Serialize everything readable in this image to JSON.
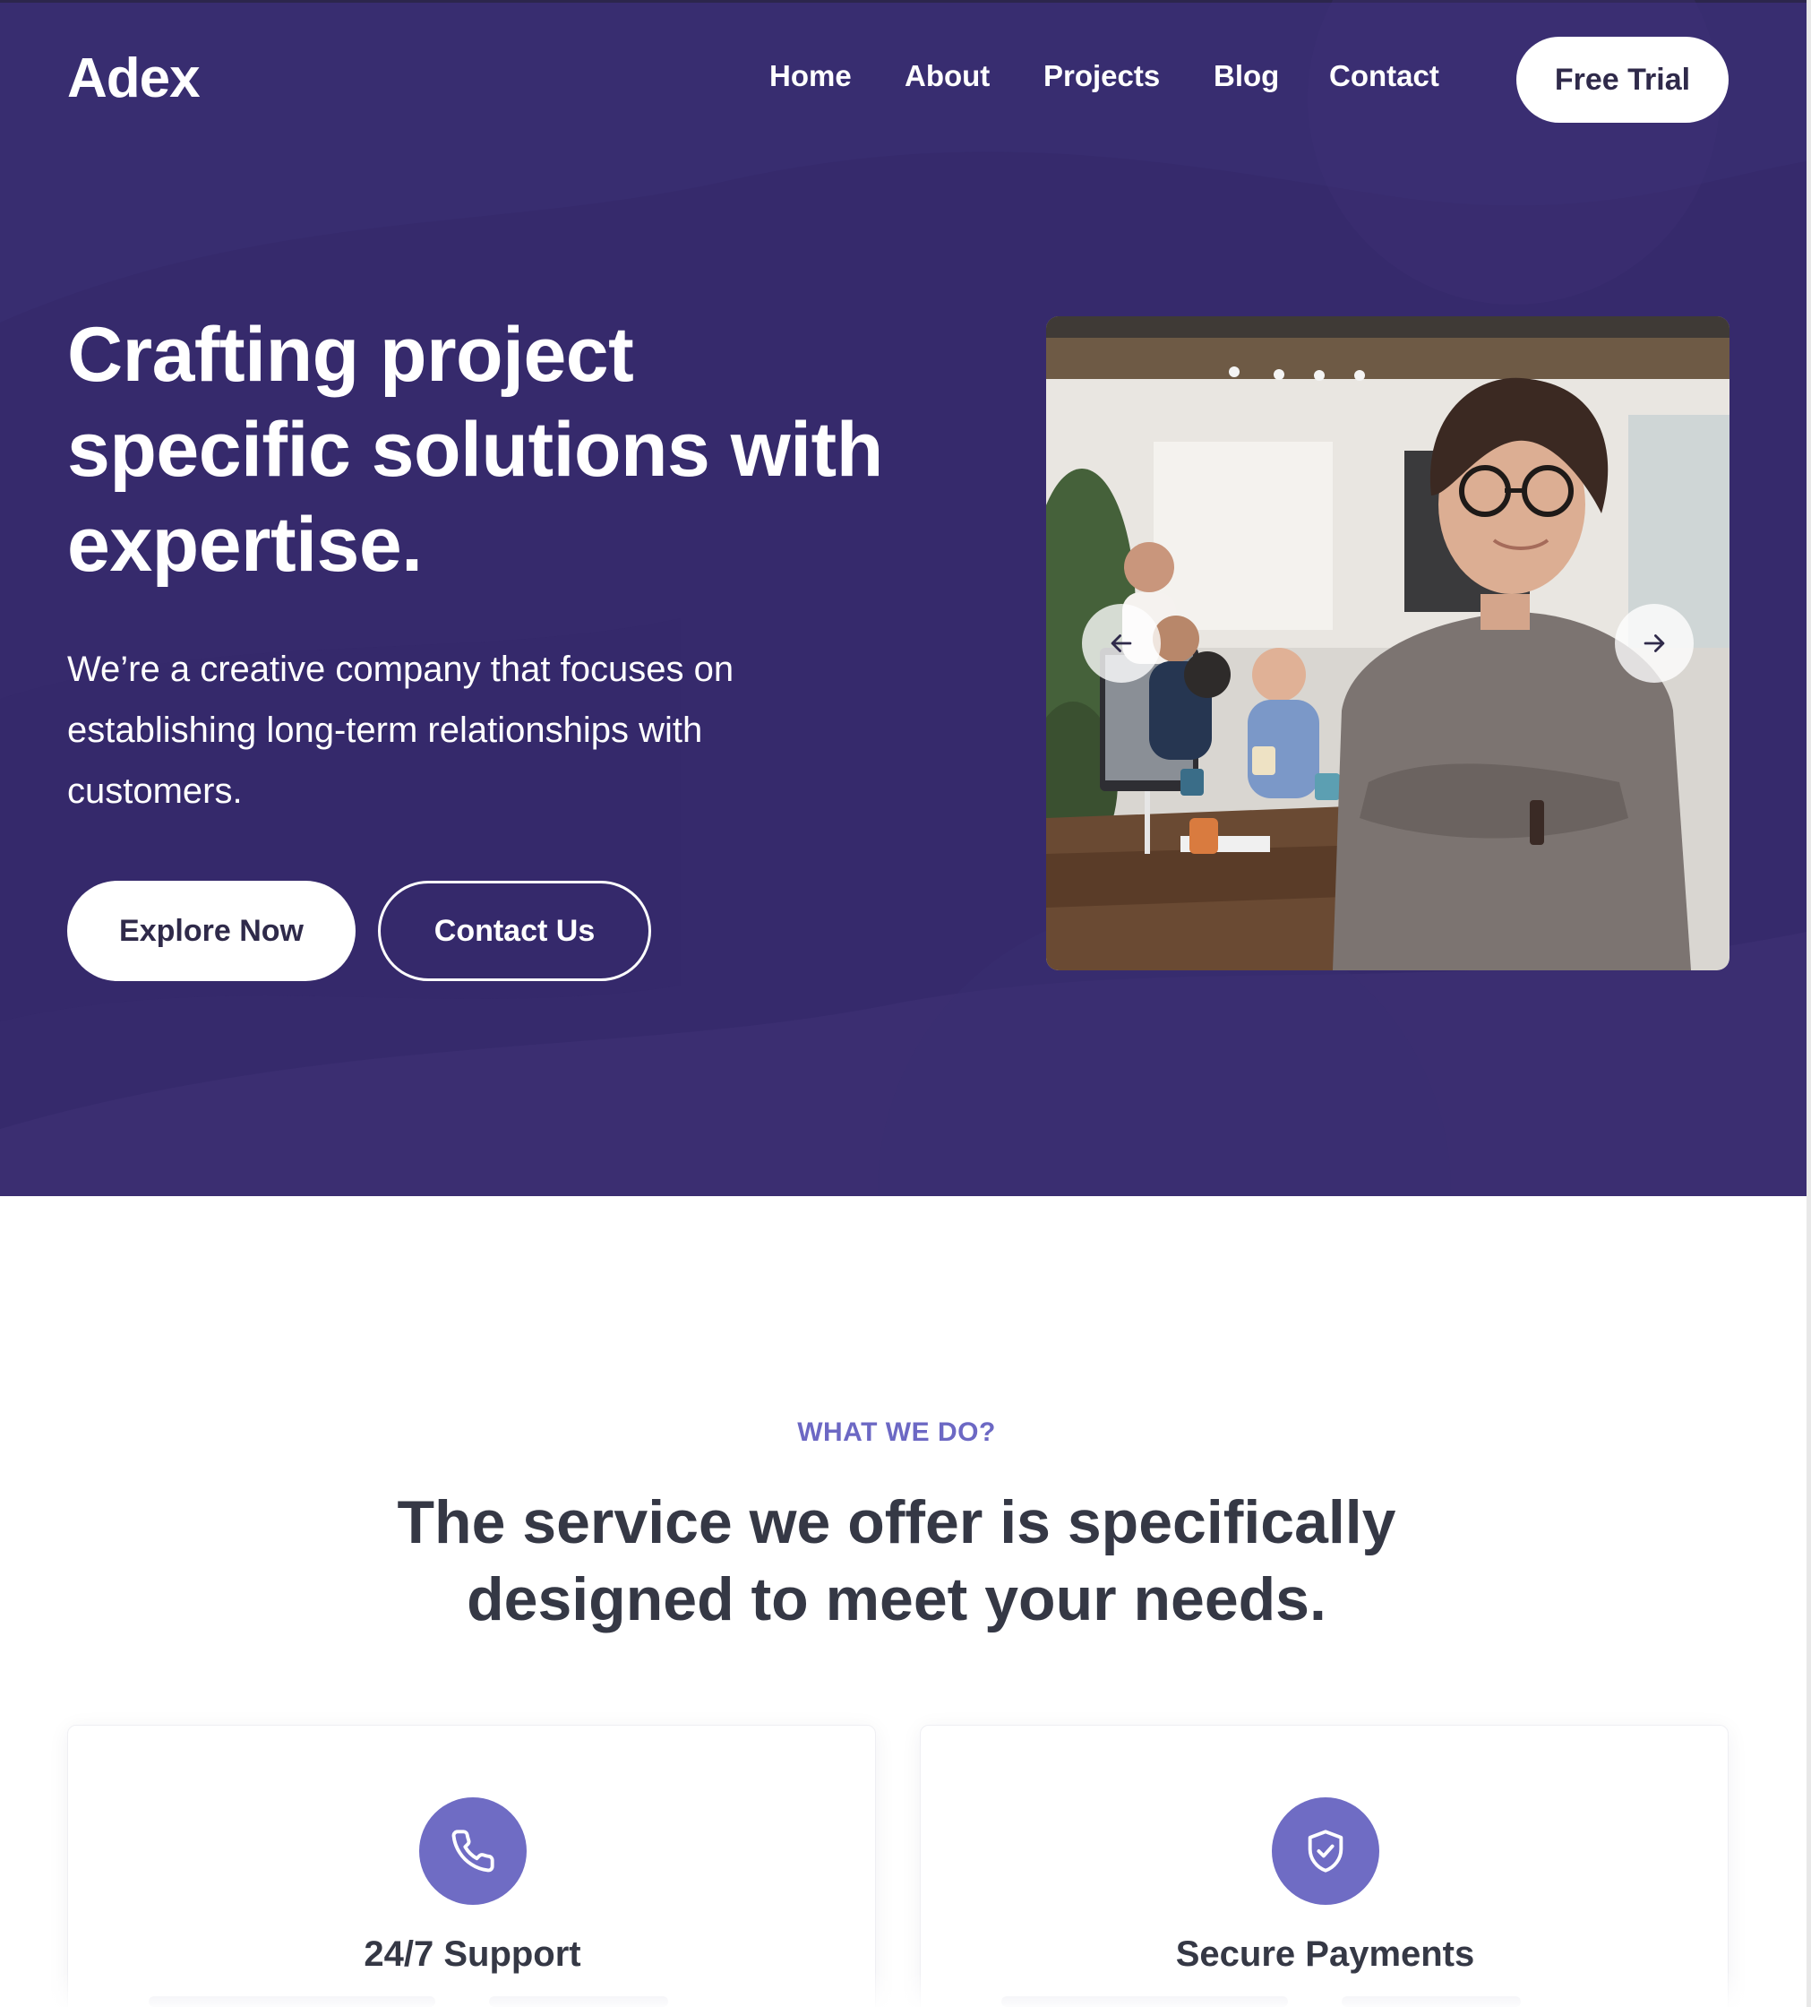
{
  "brand": {
    "logo": "Adex"
  },
  "nav": {
    "links": [
      "Home",
      "About",
      "Projects",
      "Blog",
      "Contact"
    ],
    "cta": "Free Trial"
  },
  "hero": {
    "title_lines": [
      "Crafting project",
      "specific solutions with",
      "expertise."
    ],
    "description_lines": [
      "We’re a creative company that focuses on",
      "establishing long-term relationships with",
      "customers."
    ],
    "primary_button": "Explore Now",
    "secondary_button": "Contact Us",
    "slider": {
      "prev_icon": "arrow-left-icon",
      "next_icon": "arrow-right-icon"
    }
  },
  "services": {
    "eyebrow": "WHAT WE DO?",
    "heading_lines": [
      "The service we offer is specifically",
      "designed to meet your needs."
    ],
    "cards": [
      {
        "icon": "phone-icon",
        "title": "24/7 Support"
      },
      {
        "icon": "shield-check-icon",
        "title": "Secure Payments"
      }
    ]
  },
  "colors": {
    "hero_bg": "#362a6c",
    "accent": "#6f6cc4",
    "eyebrow": "#6c68c4",
    "heading": "#353845",
    "white": "#ffffff"
  }
}
